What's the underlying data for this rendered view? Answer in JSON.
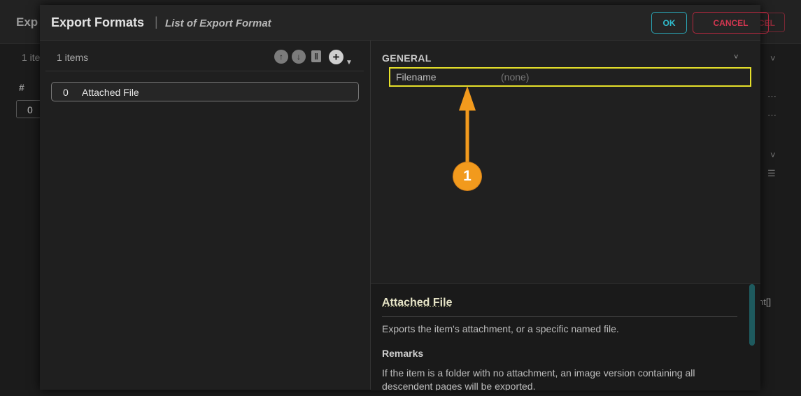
{
  "background": {
    "title": "Exp",
    "items_count": "1 ite",
    "column_hash": "#",
    "row_value": "0",
    "cancel_fragment": "CEL",
    "right_fragment": "nt[]"
  },
  "dialog": {
    "title": "Export Formats",
    "separator": "|",
    "subtitle": "List of Export Format",
    "ok_label": "OK",
    "cancel_label": "CANCEL"
  },
  "list": {
    "count": "1 items",
    "rows": [
      {
        "index": "0",
        "label": "Attached File"
      }
    ]
  },
  "properties": {
    "section": "GENERAL",
    "rows": [
      {
        "name": "Filename",
        "value": "(none)"
      }
    ]
  },
  "help": {
    "title": "Attached File",
    "description": "Exports the item's attachment, or a specific named file.",
    "remarks_heading": "Remarks",
    "remarks_text": "If the item is a folder with no attachment, an image version containing all descendent pages will be exported."
  },
  "annotation": {
    "number": "1",
    "color": "#f29a1d"
  },
  "colors": {
    "accent_ok": "#2fbccd",
    "accent_cancel": "#d23650",
    "highlight": "#e6e02a"
  }
}
